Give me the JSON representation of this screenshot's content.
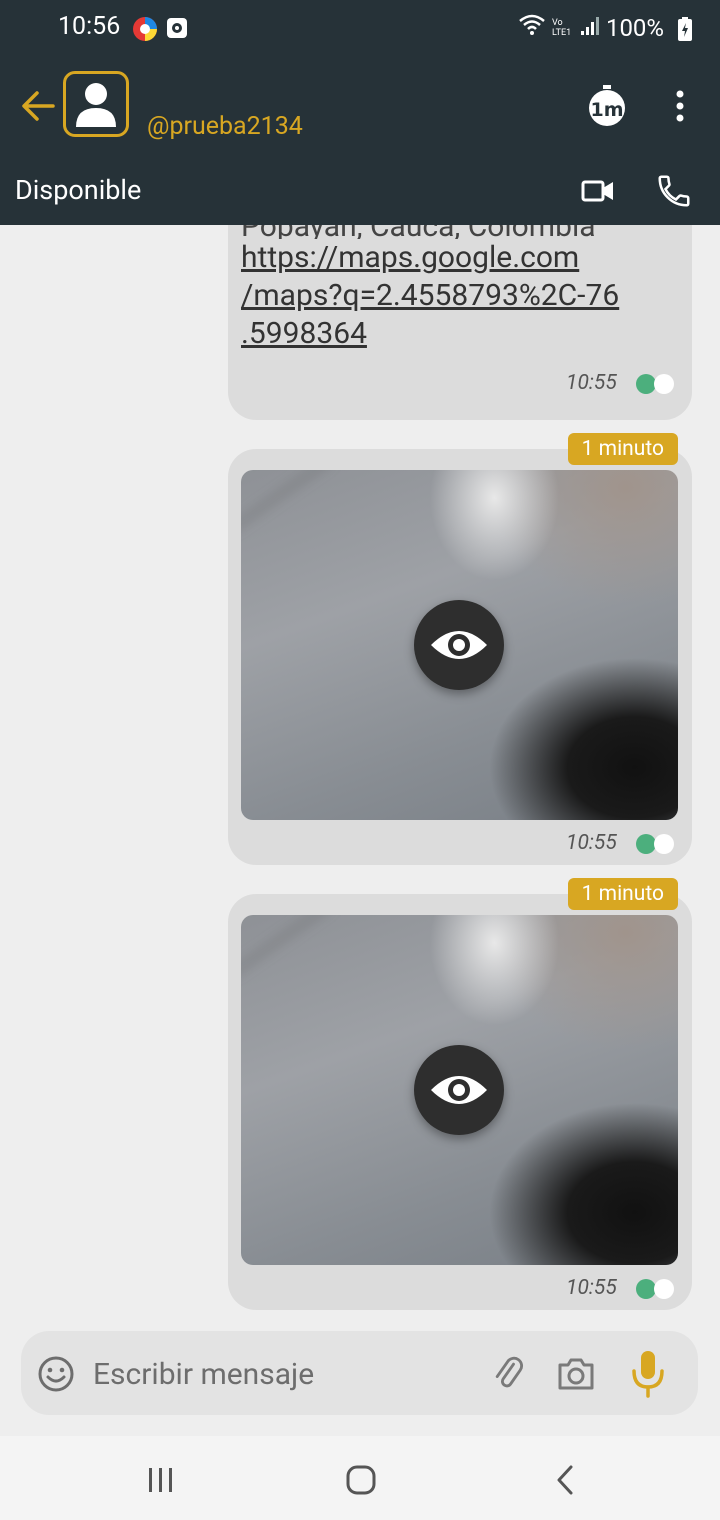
{
  "status_bar": {
    "time": "10:56",
    "network": "Vo LTE1",
    "battery": "100%"
  },
  "header": {
    "contact_name": "@prueba2134",
    "status": "Disponible",
    "timer_label": "1m",
    "accent_color": "#d8a722",
    "background_color": "#263238"
  },
  "messages": [
    {
      "type": "location",
      "partial_text": "Popayán, Cauca, Colombia",
      "link_line1": "https://maps.google.com",
      "link_line2": "/maps?q=2.4558793%2C-76",
      "link_line3": ".5998364",
      "time": "10:55"
    },
    {
      "type": "image",
      "timer_badge": "1 minuto",
      "time": "10:55"
    },
    {
      "type": "image",
      "timer_badge": "1 minuto",
      "time": "10:55"
    }
  ],
  "composer": {
    "placeholder": "Escribir mensaje"
  }
}
